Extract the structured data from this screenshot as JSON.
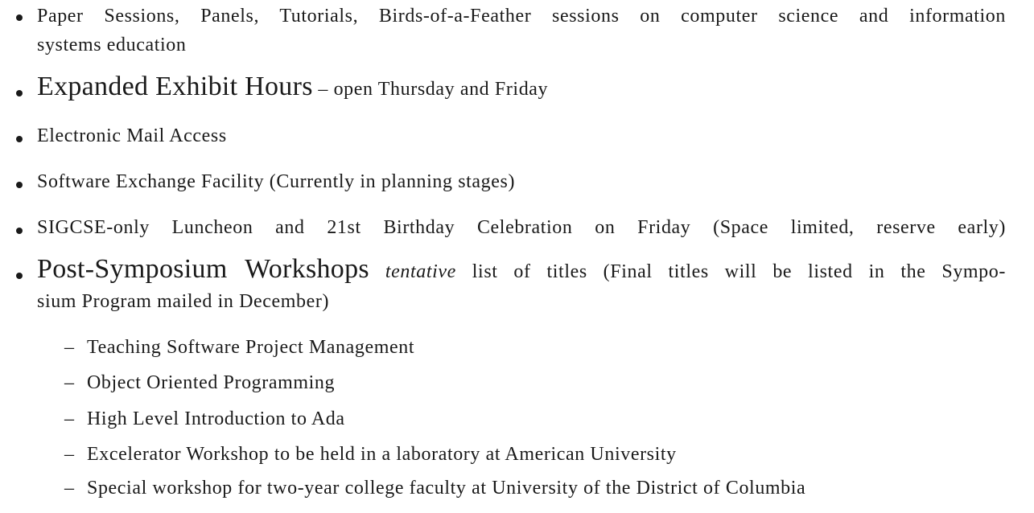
{
  "items": [
    {
      "lines": [
        "Paper Sessions, Panels, Tutorials, Birds-of-a-Feather sessions on computer science and information",
        "systems education"
      ]
    },
    {
      "title": "Expanded Exhibit Hours",
      "rest": " – open Thursday and Friday"
    },
    {
      "text": "Electronic Mail Access"
    },
    {
      "text": "Software Exchange Facility (Currently in planning stages)"
    },
    {
      "text": "SIGCSE-only Luncheon and 21st Birthday Celebration on Friday (Space limited, reserve early)"
    },
    {
      "title": "Post-Symposium Workshops",
      "emph": "tentative",
      "rest": " list of titles (Final titles will be listed in the Sympo-",
      "line2": "sium Program mailed in December)"
    }
  ],
  "workshops": [
    "Teaching Software Project Management",
    "Object Oriented Programming",
    "High Level Introduction to Ada",
    "Excelerator Workshop to be held in a laboratory at American University",
    "Special workshop for two-year college faculty at University of the District of Columbia"
  ],
  "dash": "–"
}
